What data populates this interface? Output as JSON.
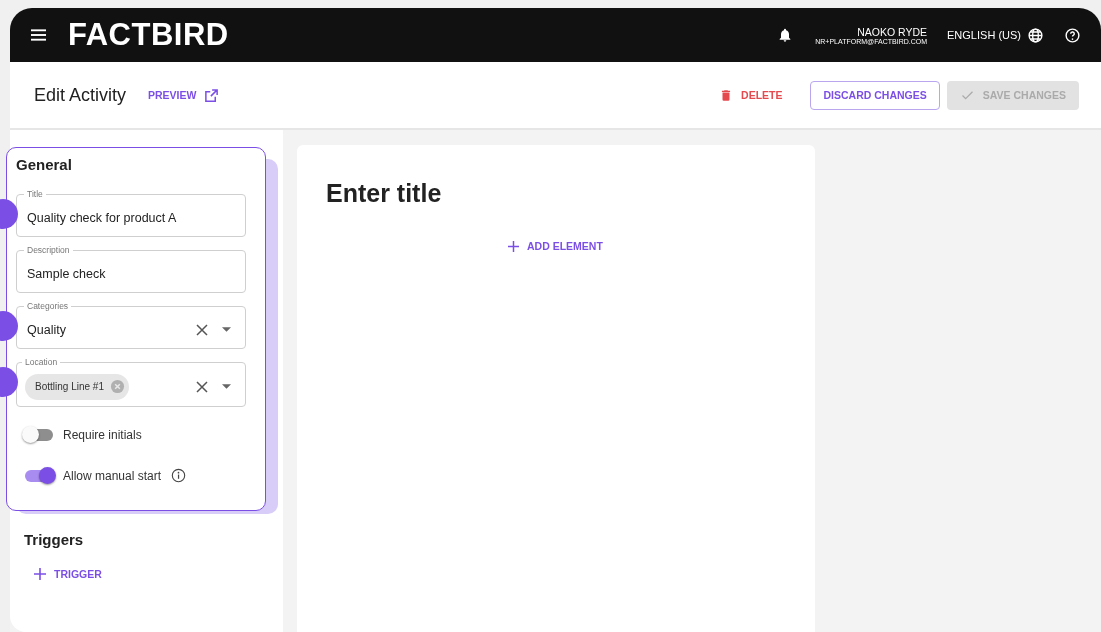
{
  "header": {
    "logo": "FACTBIRD",
    "user_name": "NAOKO RYDE",
    "user_email": "NR+PLATFORM@FACTBIRD.COM",
    "language": "ENGLISH (US)"
  },
  "toolbar": {
    "title": "Edit Activity",
    "preview": "PREVIEW",
    "delete": "DELETE",
    "discard": "DISCARD CHANGES",
    "save": {
      "label": "SAVE CHANGES",
      "disabled": true
    }
  },
  "general": {
    "heading": "General",
    "highlighted": true,
    "fields": [
      {
        "kind": "text",
        "label": "Title",
        "value": "Quality check for product A",
        "callout": true
      },
      {
        "kind": "text",
        "label": "Description",
        "value": "Sample check",
        "callout": false
      },
      {
        "kind": "select",
        "label": "Categories",
        "value": "Quality",
        "callout": true
      },
      {
        "kind": "chips",
        "label": "Location",
        "chips": [
          "Bottling Line #1"
        ],
        "callout": true
      }
    ],
    "toggles": [
      {
        "label": "Require initials",
        "on": false,
        "info": false
      },
      {
        "label": "Allow manual start",
        "on": true,
        "info": true
      }
    ]
  },
  "triggers": {
    "heading": "Triggers",
    "add": "TRIGGER"
  },
  "canvas": {
    "title": "Enter title",
    "add": "ADD ELEMENT"
  }
}
